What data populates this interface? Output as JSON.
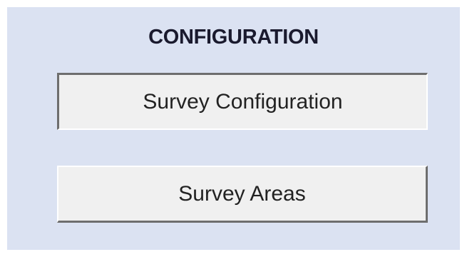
{
  "panel": {
    "title": "CONFIGURATION",
    "buttons": [
      {
        "label": "Survey Configuration",
        "state": "pressed"
      },
      {
        "label": "Survey Areas",
        "state": "normal"
      }
    ]
  },
  "colors": {
    "panel_background": "#dbe2f2",
    "button_face": "#f0f0f0",
    "title_text": "#1a1a2e"
  }
}
